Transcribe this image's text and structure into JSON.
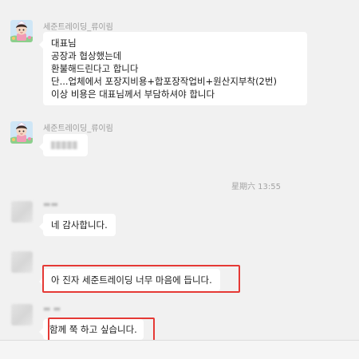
{
  "messages": [
    {
      "sender": "세준트레이딩_류이림",
      "lines": [
        "대표님",
        "공장과 협상했는데",
        "환불해드린다고 합니다",
        "단...업체에서 포장지비용+합포장작업비+원산지부착(2번)",
        "이상 비용은 대표님께서 부담하셔야 합니다"
      ]
    },
    {
      "sender": "세준트레이딩_류이림"
    },
    {
      "timestamp": "星期六 13:55"
    },
    {
      "lines": [
        "네 감사합니다."
      ]
    },
    {
      "lines": [
        "아 진자 세준트레이딩 너무 마음에 듭니다."
      ]
    },
    {
      "lines": [
        "함께 쭉 하고 싶습니다."
      ]
    }
  ],
  "colors": {
    "background": "#f1f1f1",
    "bubble": "#ffffff",
    "highlight_box": "#e53935",
    "sender_text": "#9a9a9a"
  }
}
